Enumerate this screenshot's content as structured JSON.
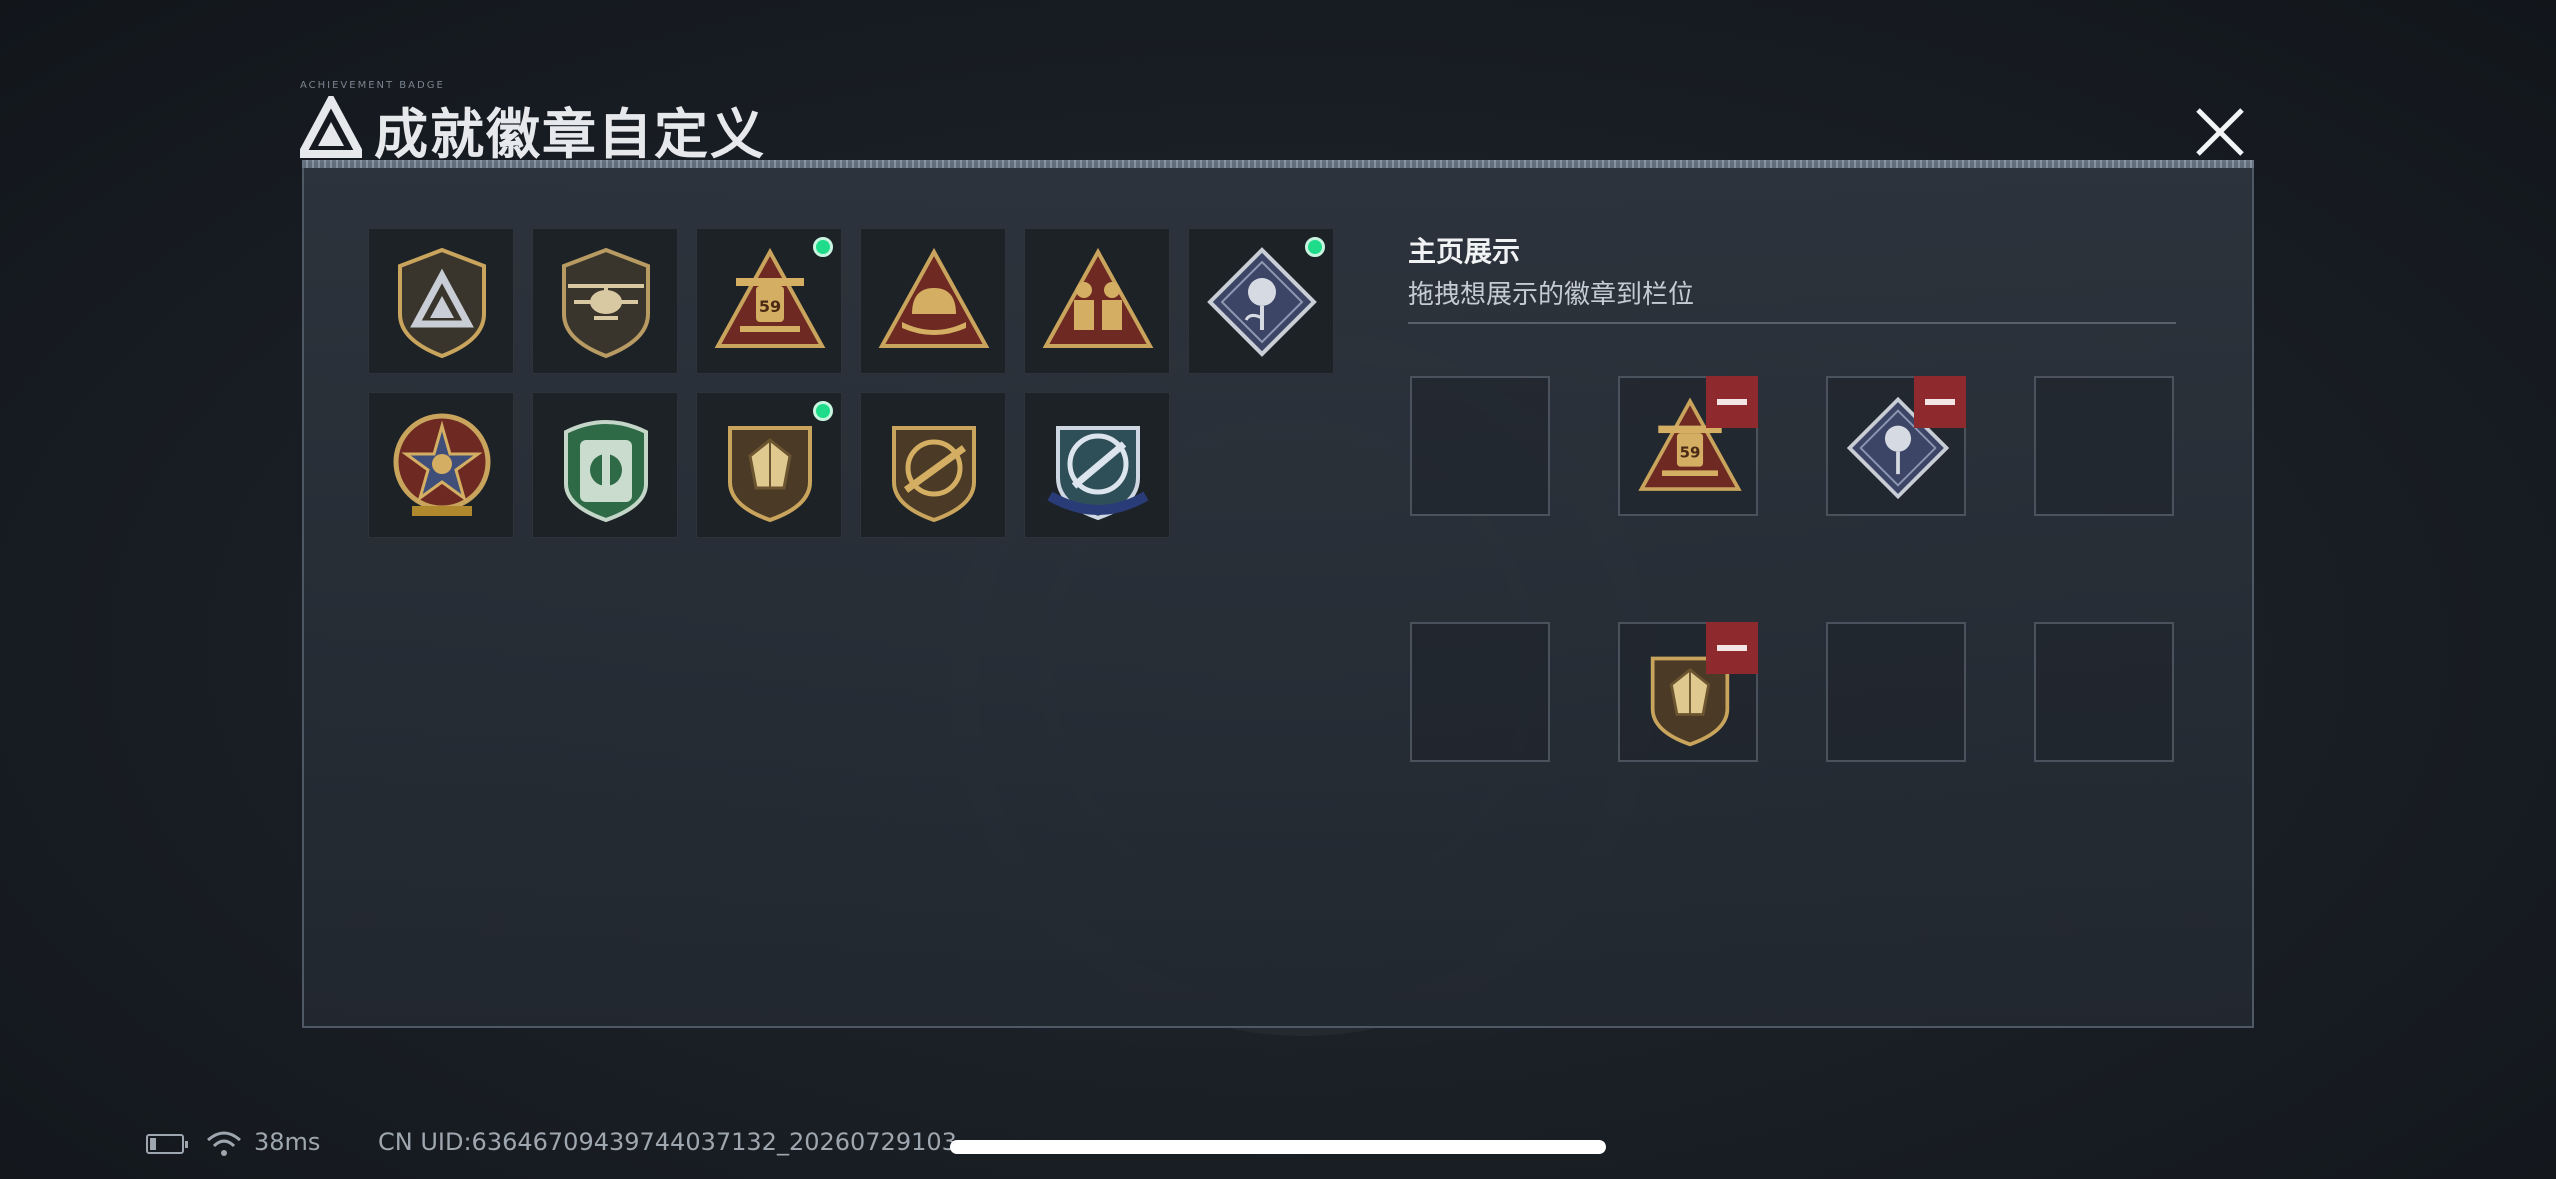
{
  "window": {
    "title": "成就徽章自定义",
    "deco_text": "ACHIEVEMENT BADGE"
  },
  "colors": {
    "accent_green": "#1edc8a",
    "remove_red": "#8e2a2d",
    "gold": "#c9a45c",
    "silver": "#c9ced6"
  },
  "badges": [
    {
      "icon": "delta-shield-badge-icon",
      "equipped": false
    },
    {
      "icon": "helicopter-shield-badge-icon",
      "equipped": false
    },
    {
      "icon": "number-59-tank-badge-icon",
      "equipped": true,
      "text": "59"
    },
    {
      "icon": "helmet-triangle-badge-icon",
      "equipped": false
    },
    {
      "icon": "soldiers-triangle-badge-icon",
      "equipped": false
    },
    {
      "icon": "rose-diamond-badge-icon",
      "equipped": true
    },
    {
      "icon": "star-compass-badge-icon",
      "equipped": false
    },
    {
      "icon": "green-shield-badge-icon",
      "equipped": false
    },
    {
      "icon": "crystal-shield-badge-icon",
      "equipped": true
    },
    {
      "icon": "rifle-shield-badge-icon",
      "equipped": false
    },
    {
      "icon": "blue-wings-badge-icon",
      "equipped": false
    }
  ],
  "showcase": {
    "title": "主页展示",
    "subtitle": "拖拽想展示的徽章到栏位",
    "slots": [
      {
        "badge": ""
      },
      {
        "badge": "number-59-tank-badge-icon",
        "text": "59"
      },
      {
        "badge": "rose-diamond-badge-icon"
      },
      {
        "badge": ""
      },
      {
        "badge": ""
      },
      {
        "badge": "crystal-shield-badge-icon"
      },
      {
        "badge": ""
      },
      {
        "badge": ""
      }
    ]
  },
  "status": {
    "ping": "38ms",
    "uid": "CN UID:6364670943974403713​2_20260729103"
  }
}
